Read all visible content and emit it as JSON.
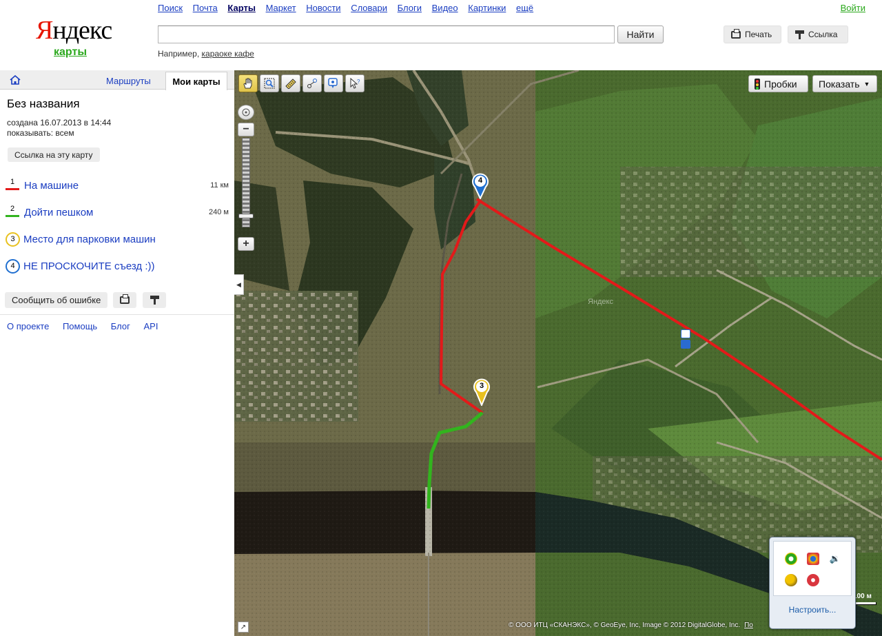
{
  "header": {
    "logo_first": "Я",
    "logo_rest": "ндекс",
    "service": "карты",
    "services": [
      {
        "label": "Поиск",
        "active": false
      },
      {
        "label": "Почта",
        "active": false
      },
      {
        "label": "Карты",
        "active": true
      },
      {
        "label": "Маркет",
        "active": false
      },
      {
        "label": "Новости",
        "active": false
      },
      {
        "label": "Словари",
        "active": false
      },
      {
        "label": "Блоги",
        "active": false
      },
      {
        "label": "Видео",
        "active": false
      },
      {
        "label": "Картинки",
        "active": false
      },
      {
        "label": "ещё",
        "active": false
      }
    ],
    "login": "Войти",
    "search_value": "",
    "search_button": "Найти",
    "example_prefix": "Например,",
    "example_query": "караоке кафе",
    "print_button": "Печать",
    "link_button": "Ссылка"
  },
  "sidebar": {
    "tabs": {
      "routes": "Маршруты",
      "my_maps": "Мои карты"
    },
    "map_title": "Без названия",
    "created": "создана 16.07.2013 в 14:44",
    "visibility": "показывать: всем",
    "link_to_map": "Ссылка на эту карту",
    "objects": [
      {
        "num": "1",
        "label": "На машине",
        "dist": "11 км",
        "kind": "line",
        "color": "#e31a1a"
      },
      {
        "num": "2",
        "label": "Дойти пешком",
        "dist": "240 м",
        "kind": "line",
        "color": "#32b41e"
      },
      {
        "num": "3",
        "label": "Место для парковки машин",
        "dist": "",
        "kind": "circle",
        "color": "#e8c11f"
      },
      {
        "num": "4",
        "label": "НЕ ПРОСКОЧИТЕ съезд :))",
        "dist": "",
        "kind": "circle",
        "color": "#1f6fd0"
      }
    ],
    "report_error": "Сообщить об ошибке",
    "footer_links": [
      "О проекте",
      "Помощь",
      "Блог",
      "API"
    ]
  },
  "map": {
    "traffic": "Пробки",
    "show": "Показать",
    "show_arrow": "▼",
    "watermark": "Яндекс",
    "copyright": "© ООО ИТЦ «СКАНЭКС», © GeoEye, Inc, Image © 2012 DigitalGlobe, Inc.",
    "terms_fragment": "По",
    "scale": "100 м",
    "markers": [
      {
        "num": "4",
        "color": "#1f6fd0"
      },
      {
        "num": "3",
        "color": "#e8c11f"
      }
    ],
    "tools": [
      "hand-icon",
      "zoom-area-icon",
      "ruler-icon",
      "route-icon",
      "placemark-icon",
      "info-icon"
    ]
  },
  "tray": {
    "setup_link": "Настроить..."
  },
  "colors": {
    "link": "#1a3dc1",
    "brand_red": "#e61400",
    "brand_green": "#2aa81c",
    "route_car": "#e31a1a",
    "route_walk": "#32b41e"
  }
}
